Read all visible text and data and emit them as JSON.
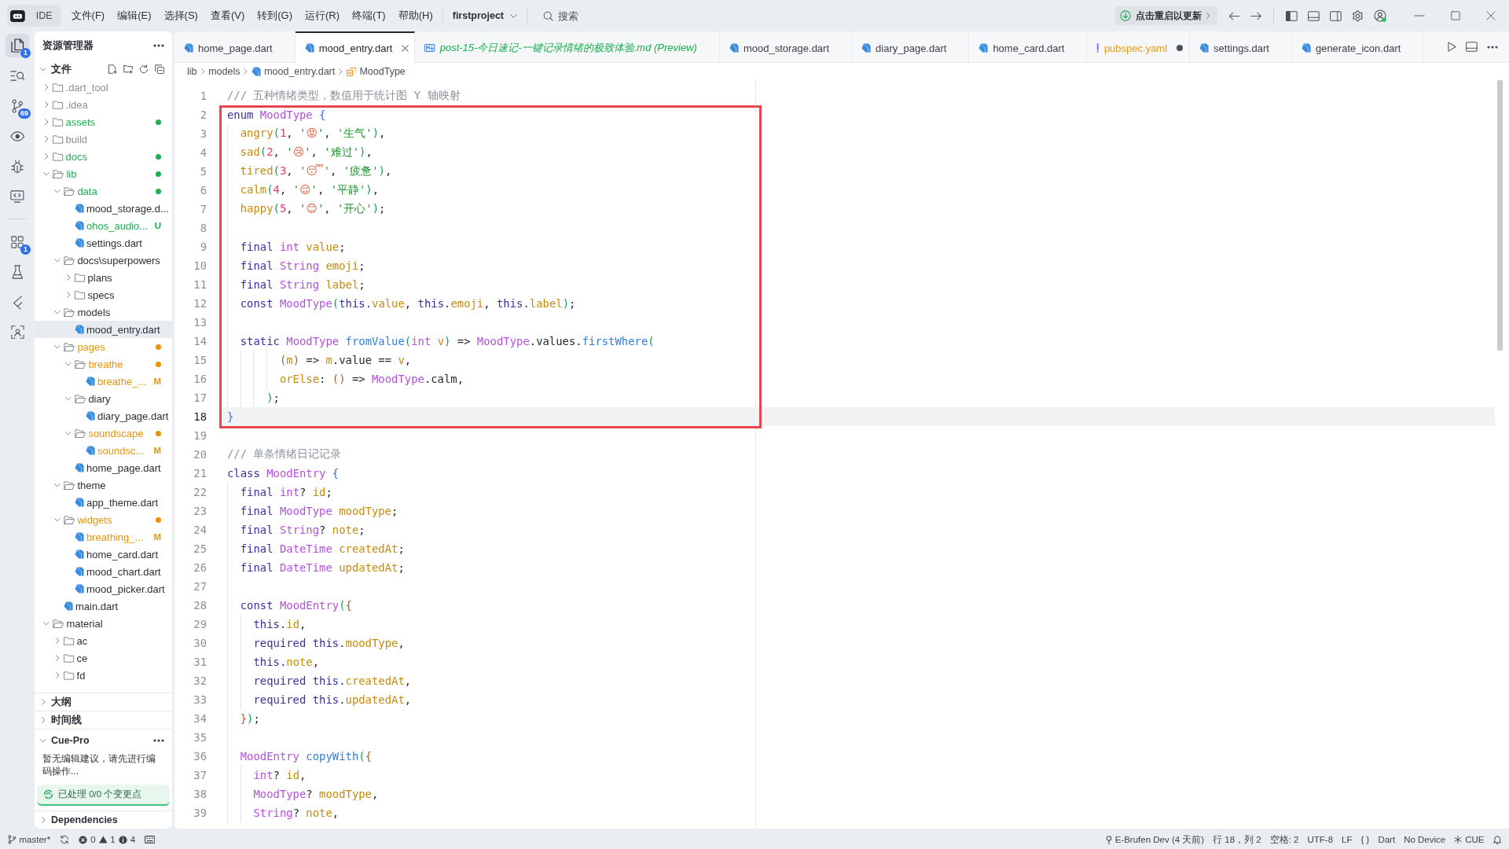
{
  "title_bar": {
    "app_name": "IDE",
    "menus": [
      "文件(F)",
      "编辑(E)",
      "选择(S)",
      "查看(V)",
      "转到(G)",
      "运行(R)",
      "终端(T)",
      "帮助(H)"
    ],
    "project": "firstproject",
    "search": {
      "placeholder": "搜索"
    },
    "update_button": "点击重启以更新"
  },
  "activity_bar": {
    "groups": [
      {
        "items": [
          {
            "kind": "explorer",
            "selected": true,
            "badge": "1"
          },
          {
            "kind": "search",
            "selected": false
          },
          {
            "kind": "source_control",
            "selected": false,
            "badge": "69"
          },
          {
            "kind": "preview",
            "selected": false
          },
          {
            "kind": "debug",
            "selected": false
          },
          {
            "kind": "remote",
            "selected": false
          }
        ]
      },
      {
        "items": [
          {
            "kind": "extensions",
            "selected": false,
            "badge": "1"
          },
          {
            "kind": "testing",
            "selected": false
          },
          {
            "kind": "chevrons",
            "selected": false
          },
          {
            "kind": "scan",
            "selected": false
          }
        ]
      }
    ]
  },
  "sidebar": {
    "title": "资源管理器",
    "sections": [
      {
        "title": "文件",
        "kind": "files",
        "expanded": true,
        "tree": [
          {
            "name": ".dart_tool",
            "kind": "folder",
            "expanded": false,
            "selected": false,
            "dot": false,
            "color": "#8b9098"
          },
          {
            "name": ".idea",
            "kind": "folder",
            "expanded": false,
            "selected": false,
            "dot": false,
            "color": "#8b9098"
          },
          {
            "name": "assets",
            "kind": "folder",
            "expanded": false,
            "selected": false,
            "dot": true,
            "color": "#1fae52"
          },
          {
            "name": "build",
            "kind": "folder",
            "expanded": false,
            "selected": false,
            "dot": false,
            "color": "#8b9098"
          },
          {
            "name": "docs",
            "kind": "folder",
            "expanded": false,
            "selected": false,
            "dot": true,
            "color": "#1fae52"
          },
          {
            "name": "lib",
            "kind": "folder",
            "expanded": true,
            "selected": false,
            "dot": true,
            "color": "#1fae52",
            "children": [
              {
                "name": "data",
                "kind": "folder",
                "expanded": true,
                "selected": false,
                "dot": true,
                "color": "#1fae52",
                "children": [
                  {
                    "name": "mood_storage.d...",
                    "kind": "file",
                    "selected": false
                  },
                  {
                    "name": "ohos_audio...",
                    "kind": "file",
                    "selected": false,
                    "color": "#1fae52",
                    "badge": "U"
                  },
                  {
                    "name": "settings.dart",
                    "kind": "file",
                    "selected": false
                  }
                ]
              },
              {
                "name": "docs\\superpowers",
                "kind": "folder",
                "expanded": true,
                "selected": false,
                "dot": false,
                "children": [
                  {
                    "name": "plans",
                    "kind": "folder",
                    "expanded": false,
                    "selected": false,
                    "dot": false
                  },
                  {
                    "name": "specs",
                    "kind": "folder",
                    "expanded": false,
                    "selected": false,
                    "dot": false
                  }
                ]
              },
              {
                "name": "models",
                "kind": "folder",
                "expanded": true,
                "selected": false,
                "dot": false,
                "children": [
                  {
                    "name": "mood_entry.dart",
                    "kind": "file",
                    "selected": true
                  }
                ]
              },
              {
                "name": "pages",
                "kind": "folder",
                "expanded": true,
                "selected": false,
                "dot": true,
                "color": "#e8940a",
                "children": [
                  {
                    "name": "breathe",
                    "kind": "folder",
                    "expanded": true,
                    "selected": false,
                    "dot": true,
                    "color": "#e8940a",
                    "children": [
                      {
                        "name": "breathe_...",
                        "kind": "file",
                        "selected": false,
                        "color": "#e8940a",
                        "badge": "M"
                      }
                    ]
                  },
                  {
                    "name": "diary",
                    "kind": "folder",
                    "expanded": true,
                    "selected": false,
                    "dot": false,
                    "children": [
                      {
                        "name": "diary_page.dart",
                        "kind": "file",
                        "selected": false
                      }
                    ]
                  },
                  {
                    "name": "soundscape",
                    "kind": "folder",
                    "expanded": true,
                    "selected": false,
                    "dot": true,
                    "color": "#e8940a",
                    "children": [
                      {
                        "name": "soundsc...",
                        "kind": "file",
                        "selected": false,
                        "color": "#e8940a",
                        "badge": "M"
                      }
                    ]
                  },
                  {
                    "name": "home_page.dart",
                    "kind": "file",
                    "selected": false
                  }
                ]
              },
              {
                "name": "theme",
                "kind": "folder",
                "expanded": true,
                "selected": false,
                "dot": false,
                "children": [
                  {
                    "name": "app_theme.dart",
                    "kind": "file",
                    "selected": false
                  }
                ]
              },
              {
                "name": "widgets",
                "kind": "folder",
                "expanded": true,
                "selected": false,
                "dot": true,
                "color": "#e8940a",
                "children": [
                  {
                    "name": "breathing_...",
                    "kind": "file",
                    "selected": false,
                    "color": "#e8940a",
                    "badge": "M"
                  },
                  {
                    "name": "home_card.dart",
                    "kind": "file",
                    "selected": false
                  },
                  {
                    "name": "mood_chart.dart",
                    "kind": "file",
                    "selected": false
                  },
                  {
                    "name": "mood_picker.dart",
                    "kind": "file",
                    "selected": false
                  }
                ]
              },
              {
                "name": "main.dart",
                "kind": "file",
                "selected": false
              }
            ]
          },
          {
            "name": "material",
            "kind": "folder",
            "expanded": true,
            "selected": false,
            "dot": false,
            "children": [
              {
                "name": "ac",
                "kind": "folder",
                "expanded": false,
                "selected": false,
                "dot": false
              },
              {
                "name": "ce",
                "kind": "folder",
                "expanded": false,
                "selected": false,
                "dot": false
              },
              {
                "name": "fd",
                "kind": "folder",
                "expanded": false,
                "selected": false,
                "dot": false
              }
            ]
          }
        ]
      },
      {
        "title": "大纲",
        "kind": "outline",
        "expanded": false
      },
      {
        "title": "时间线",
        "kind": "timeline",
        "expanded": false
      },
      {
        "title": "Cue-Pro",
        "kind": "cue",
        "expanded": true,
        "message": "暂无编辑建议，请先进行编码操作...",
        "progress": "已处理 0/0 个变更点"
      },
      {
        "title": "Dependencies",
        "kind": "dependencies",
        "expanded": false
      }
    ]
  },
  "editor": {
    "tabs": [
      {
        "label": "home_page.dart",
        "kind": "dart",
        "selected": false,
        "preview": false,
        "unsaved": false
      },
      {
        "label": "mood_entry.dart",
        "kind": "dart",
        "selected": true,
        "preview": false,
        "unsaved": false
      },
      {
        "label": "post-15-今日速记-一键记录情绪的极致体验.md (Preview)",
        "kind": "markdown",
        "selected": false,
        "preview": true,
        "unsaved": false,
        "color": "#18b04f"
      },
      {
        "label": "mood_storage.dart",
        "kind": "dart",
        "selected": false,
        "preview": false,
        "unsaved": false
      },
      {
        "label": "diary_page.dart",
        "kind": "dart",
        "selected": false,
        "preview": false,
        "unsaved": false
      },
      {
        "label": "home_card.dart",
        "kind": "dart",
        "selected": false,
        "preview": false,
        "unsaved": false
      },
      {
        "label": "pubspec.yaml",
        "kind": "yaml",
        "selected": false,
        "preview": false,
        "unsaved": true,
        "color": "#ec9a0f"
      },
      {
        "label": "settings.dart",
        "kind": "dart",
        "selected": false,
        "preview": false,
        "unsaved": false
      },
      {
        "label": "generate_icon.dart",
        "kind": "dart",
        "selected": false,
        "preview": false,
        "unsaved": false
      }
    ],
    "breadcrumb": [
      {
        "label": "lib",
        "kind": "folder"
      },
      {
        "label": "models",
        "kind": "folder"
      },
      {
        "label": "mood_entry.dart",
        "kind": "file"
      },
      {
        "label": "MoodType",
        "kind": "symbol"
      }
    ],
    "code": {
      "blocks": [
        {
          "kind": "plain",
          "lines": [
            {
              "number": "1",
              "current": false,
              "tokens": [
                {
                  "kind": "comment",
                  "text": "/// 五种情绪类型，数值用于统计图 Y 轴映射"
                }
              ]
            }
          ]
        },
        {
          "kind": "boxed",
          "lines": [
            {
              "number": "2",
              "current": false,
              "tokens": [
                {
                  "kind": "keyword",
                  "text": "enum"
                },
                {
                  "kind": "type",
                  "text": " MoodType"
                },
                {
                  "kind": "bracket1",
                  "text": " {"
                }
              ]
            },
            {
              "number": "3",
              "current": false,
              "tokens": [
                {
                  "kind": "field",
                  "text": "  angry"
                },
                {
                  "kind": "bracket2",
                  "text": "("
                },
                {
                  "kind": "number",
                  "text": "1"
                },
                {
                  "kind": "punct",
                  "text": ", "
                },
                {
                  "kind": "string",
                  "text": "'"
                },
                {
                  "kind": "emoji",
                  "text": "😡"
                },
                {
                  "kind": "string",
                  "text": "'"
                },
                {
                  "kind": "punct",
                  "text": ", "
                },
                {
                  "kind": "string",
                  "text": "'生气'"
                },
                {
                  "kind": "bracket2",
                  "text": ")"
                },
                {
                  "kind": "punct",
                  "text": ","
                }
              ]
            },
            {
              "number": "4",
              "current": false,
              "tokens": [
                {
                  "kind": "field",
                  "text": "  sad"
                },
                {
                  "kind": "bracket2",
                  "text": "("
                },
                {
                  "kind": "number",
                  "text": "2"
                },
                {
                  "kind": "punct",
                  "text": ", "
                },
                {
                  "kind": "string",
                  "text": "'"
                },
                {
                  "kind": "emoji",
                  "text": "😢"
                },
                {
                  "kind": "string",
                  "text": "'"
                },
                {
                  "kind": "punct",
                  "text": ", "
                },
                {
                  "kind": "string",
                  "text": "'难过'"
                },
                {
                  "kind": "bracket2",
                  "text": ")"
                },
                {
                  "kind": "punct",
                  "text": ","
                }
              ]
            },
            {
              "number": "5",
              "current": false,
              "tokens": [
                {
                  "kind": "field",
                  "text": "  tired"
                },
                {
                  "kind": "bracket2",
                  "text": "("
                },
                {
                  "kind": "number",
                  "text": "3"
                },
                {
                  "kind": "punct",
                  "text": ", "
                },
                {
                  "kind": "string",
                  "text": "'"
                },
                {
                  "kind": "emoji",
                  "text": "😴"
                },
                {
                  "kind": "string",
                  "text": "'"
                },
                {
                  "kind": "punct",
                  "text": ", "
                },
                {
                  "kind": "string",
                  "text": "'疲惫'"
                },
                {
                  "kind": "bracket2",
                  "text": ")"
                },
                {
                  "kind": "punct",
                  "text": ","
                }
              ]
            },
            {
              "number": "6",
              "current": false,
              "tokens": [
                {
                  "kind": "field",
                  "text": "  calm"
                },
                {
                  "kind": "bracket2",
                  "text": "("
                },
                {
                  "kind": "number",
                  "text": "4"
                },
                {
                  "kind": "punct",
                  "text": ", "
                },
                {
                  "kind": "string",
                  "text": "'"
                },
                {
                  "kind": "emoji",
                  "text": "😌"
                },
                {
                  "kind": "string",
                  "text": "'"
                },
                {
                  "kind": "punct",
                  "text": ", "
                },
                {
                  "kind": "string",
                  "text": "'平静'"
                },
                {
                  "kind": "bracket2",
                  "text": ")"
                },
                {
                  "kind": "punct",
                  "text": ","
                }
              ]
            },
            {
              "number": "7",
              "current": false,
              "tokens": [
                {
                  "kind": "field",
                  "text": "  happy"
                },
                {
                  "kind": "bracket2",
                  "text": "("
                },
                {
                  "kind": "number",
                  "text": "5"
                },
                {
                  "kind": "punct",
                  "text": ", "
                },
                {
                  "kind": "string",
                  "text": "'"
                },
                {
                  "kind": "emoji",
                  "text": "😊"
                },
                {
                  "kind": "string",
                  "text": "'"
                },
                {
                  "kind": "punct",
                  "text": ", "
                },
                {
                  "kind": "string",
                  "text": "'开心'"
                },
                {
                  "kind": "bracket2",
                  "text": ")"
                },
                {
                  "kind": "punct",
                  "text": ";"
                }
              ]
            },
            {
              "number": "8",
              "current": false
            },
            {
              "number": "9",
              "current": false,
              "tokens": [
                {
                  "kind": "keyword",
                  "text": "  final"
                },
                {
                  "kind": "type",
                  "text": " int"
                },
                {
                  "kind": "field",
                  "text": " value"
                },
                {
                  "kind": "punct",
                  "text": ";"
                }
              ]
            },
            {
              "number": "10",
              "current": false,
              "tokens": [
                {
                  "kind": "keyword",
                  "text": "  final"
                },
                {
                  "kind": "type",
                  "text": " String"
                },
                {
                  "kind": "field",
                  "text": " emoji"
                },
                {
                  "kind": "punct",
                  "text": ";"
                }
              ]
            },
            {
              "number": "11",
              "current": false,
              "tokens": [
                {
                  "kind": "keyword",
                  "text": "  final"
                },
                {
                  "kind": "type",
                  "text": " String"
                },
                {
                  "kind": "field",
                  "text": " label"
                },
                {
                  "kind": "punct",
                  "text": ";"
                }
              ]
            },
            {
              "number": "12",
              "current": false,
              "tokens": [
                {
                  "kind": "keyword",
                  "text": "  const"
                },
                {
                  "kind": "type",
                  "text": " MoodType"
                },
                {
                  "kind": "bracket2",
                  "text": "("
                },
                {
                  "kind": "keyword",
                  "text": "this."
                },
                {
                  "kind": "field",
                  "text": "value"
                },
                {
                  "kind": "punct",
                  "text": ", "
                },
                {
                  "kind": "keyword",
                  "text": "this."
                },
                {
                  "kind": "field",
                  "text": "emoji"
                },
                {
                  "kind": "punct",
                  "text": ", "
                },
                {
                  "kind": "keyword",
                  "text": "this."
                },
                {
                  "kind": "field",
                  "text": "label"
                },
                {
                  "kind": "bracket2",
                  "text": ")"
                },
                {
                  "kind": "punct",
                  "text": ";"
                }
              ]
            },
            {
              "number": "13",
              "current": false
            },
            {
              "number": "14",
              "current": false,
              "tokens": [
                {
                  "kind": "keyword",
                  "text": "  static"
                },
                {
                  "kind": "type",
                  "text": " MoodType"
                },
                {
                  "kind": "function",
                  "text": " fromValue"
                },
                {
                  "kind": "bracket2",
                  "text": "("
                },
                {
                  "kind": "type",
                  "text": "int"
                },
                {
                  "kind": "field",
                  "text": " v"
                },
                {
                  "kind": "bracket2",
                  "text": ")"
                },
                {
                  "kind": "punct",
                  "text": " => "
                },
                {
                  "kind": "type",
                  "text": "MoodType"
                },
                {
                  "kind": "punct",
                  "text": ".values."
                },
                {
                  "kind": "function",
                  "text": "firstWhere"
                },
                {
                  "kind": "bracket2",
                  "text": "("
                }
              ]
            },
            {
              "number": "15",
              "current": false,
              "tokens": [
                {
                  "kind": "bracket3",
                  "text": "        ("
                },
                {
                  "kind": "field",
                  "text": "m"
                },
                {
                  "kind": "bracket3",
                  "text": ")"
                },
                {
                  "kind": "punct",
                  "text": " => "
                },
                {
                  "kind": "field",
                  "text": "m"
                },
                {
                  "kind": "punct",
                  "text": ".value == "
                },
                {
                  "kind": "field",
                  "text": "v"
                },
                {
                  "kind": "punct",
                  "text": ","
                }
              ]
            },
            {
              "number": "16",
              "current": false,
              "tokens": [
                {
                  "kind": "field",
                  "text": "        orElse"
                },
                {
                  "kind": "punct",
                  "text": ": "
                },
                {
                  "kind": "bracket3",
                  "text": "()"
                },
                {
                  "kind": "punct",
                  "text": " => "
                },
                {
                  "kind": "type",
                  "text": "MoodType"
                },
                {
                  "kind": "punct",
                  "text": ".calm,"
                }
              ]
            },
            {
              "number": "17",
              "current": false,
              "tokens": [
                {
                  "kind": "bracket2",
                  "text": "      )"
                },
                {
                  "kind": "punct",
                  "text": ";"
                }
              ]
            },
            {
              "number": "18",
              "current": true,
              "tokens": [
                {
                  "kind": "bracket1",
                  "text": "}"
                }
              ]
            }
          ]
        },
        {
          "kind": "plain",
          "lines": [
            {
              "number": "19",
              "current": false
            },
            {
              "number": "20",
              "current": false,
              "tokens": [
                {
                  "kind": "comment",
                  "text": "/// 单条情绪日记记录"
                }
              ]
            },
            {
              "number": "21",
              "current": false,
              "tokens": [
                {
                  "kind": "keyword",
                  "text": "class"
                },
                {
                  "kind": "type",
                  "text": " MoodEntry"
                },
                {
                  "kind": "bracket1",
                  "text": " {"
                }
              ]
            },
            {
              "number": "22",
              "current": false,
              "tokens": [
                {
                  "kind": "keyword",
                  "text": "  final"
                },
                {
                  "kind": "type",
                  "text": " int"
                },
                {
                  "kind": "punct",
                  "text": "?"
                },
                {
                  "kind": "field",
                  "text": " id"
                },
                {
                  "kind": "punct",
                  "text": ";"
                }
              ]
            },
            {
              "number": "23",
              "current": false,
              "tokens": [
                {
                  "kind": "keyword",
                  "text": "  final"
                },
                {
                  "kind": "type",
                  "text": " MoodType"
                },
                {
                  "kind": "field",
                  "text": " moodType"
                },
                {
                  "kind": "punct",
                  "text": ";"
                }
              ]
            },
            {
              "number": "24",
              "current": false,
              "tokens": [
                {
                  "kind": "keyword",
                  "text": "  final"
                },
                {
                  "kind": "type",
                  "text": " String"
                },
                {
                  "kind": "punct",
                  "text": "?"
                },
                {
                  "kind": "field",
                  "text": " note"
                },
                {
                  "kind": "punct",
                  "text": ";"
                }
              ]
            },
            {
              "number": "25",
              "current": false,
              "tokens": [
                {
                  "kind": "keyword",
                  "text": "  final"
                },
                {
                  "kind": "type",
                  "text": " DateTime"
                },
                {
                  "kind": "field",
                  "text": " createdAt"
                },
                {
                  "kind": "punct",
                  "text": ";"
                }
              ]
            },
            {
              "number": "26",
              "current": false,
              "tokens": [
                {
                  "kind": "keyword",
                  "text": "  final"
                },
                {
                  "kind": "type",
                  "text": " DateTime"
                },
                {
                  "kind": "field",
                  "text": " updatedAt"
                },
                {
                  "kind": "punct",
                  "text": ";"
                }
              ]
            },
            {
              "number": "27",
              "current": false
            },
            {
              "number": "28",
              "current": false,
              "tokens": [
                {
                  "kind": "keyword",
                  "text": "  const"
                },
                {
                  "kind": "type",
                  "text": " MoodEntry"
                },
                {
                  "kind": "bracket2",
                  "text": "("
                },
                {
                  "kind": "bracket3",
                  "text": "{"
                }
              ]
            },
            {
              "number": "29",
              "current": false,
              "tokens": [
                {
                  "kind": "keyword",
                  "text": "    this."
                },
                {
                  "kind": "field",
                  "text": "id"
                },
                {
                  "kind": "punct",
                  "text": ","
                }
              ]
            },
            {
              "number": "30",
              "current": false,
              "tokens": [
                {
                  "kind": "keyword",
                  "text": "    required this."
                },
                {
                  "kind": "field",
                  "text": "moodType"
                },
                {
                  "kind": "punct",
                  "text": ","
                }
              ]
            },
            {
              "number": "31",
              "current": false,
              "tokens": [
                {
                  "kind": "keyword",
                  "text": "    this."
                },
                {
                  "kind": "field",
                  "text": "note"
                },
                {
                  "kind": "punct",
                  "text": ","
                }
              ]
            },
            {
              "number": "32",
              "current": false,
              "tokens": [
                {
                  "kind": "keyword",
                  "text": "    required this."
                },
                {
                  "kind": "field",
                  "text": "createdAt"
                },
                {
                  "kind": "punct",
                  "text": ","
                }
              ]
            },
            {
              "number": "33",
              "current": false,
              "tokens": [
                {
                  "kind": "keyword",
                  "text": "    required this."
                },
                {
                  "kind": "field",
                  "text": "updatedAt"
                },
                {
                  "kind": "punct",
                  "text": ","
                }
              ]
            },
            {
              "number": "34",
              "current": false,
              "tokens": [
                {
                  "kind": "bracket3",
                  "text": "  }"
                },
                {
                  "kind": "bracket2",
                  "text": ")"
                },
                {
                  "kind": "punct",
                  "text": ";"
                }
              ]
            },
            {
              "number": "35",
              "current": false
            },
            {
              "number": "36",
              "current": false,
              "tokens": [
                {
                  "kind": "type",
                  "text": "  MoodEntry"
                },
                {
                  "kind": "function",
                  "text": " copyWith"
                },
                {
                  "kind": "bracket2",
                  "text": "("
                },
                {
                  "kind": "bracket3",
                  "text": "{"
                }
              ]
            },
            {
              "number": "37",
              "current": false,
              "tokens": [
                {
                  "kind": "type",
                  "text": "    int"
                },
                {
                  "kind": "punct",
                  "text": "?"
                },
                {
                  "kind": "field",
                  "text": " id"
                },
                {
                  "kind": "punct",
                  "text": ","
                }
              ]
            },
            {
              "number": "38",
              "current": false,
              "tokens": [
                {
                  "kind": "type",
                  "text": "    MoodType"
                },
                {
                  "kind": "punct",
                  "text": "?"
                },
                {
                  "kind": "field",
                  "text": " moodType"
                },
                {
                  "kind": "punct",
                  "text": ","
                }
              ]
            },
            {
              "number": "39",
              "current": false,
              "tokens": [
                {
                  "kind": "type",
                  "text": "    String"
                },
                {
                  "kind": "punct",
                  "text": "?"
                },
                {
                  "kind": "field",
                  "text": " note"
                },
                {
                  "kind": "punct",
                  "text": ","
                }
              ]
            }
          ]
        }
      ]
    }
  },
  "status_bar": {
    "branch": "master*",
    "errors": "0",
    "warnings": "1",
    "infos": "4",
    "items": [
      {
        "label": "E-Brufen Dev (4 天前)",
        "kind": "blame"
      },
      {
        "label": "行 18，列 2",
        "kind": "text"
      },
      {
        "label": "空格: 2",
        "kind": "text"
      },
      {
        "label": "UTF-8",
        "kind": "text"
      },
      {
        "label": "LF",
        "kind": "text"
      },
      {
        "label": "{ }",
        "kind": "text"
      },
      {
        "label": "Dart",
        "kind": "text"
      },
      {
        "label": "No Device",
        "kind": "text"
      },
      {
        "label": "CUE",
        "kind": "cue"
      }
    ]
  }
}
